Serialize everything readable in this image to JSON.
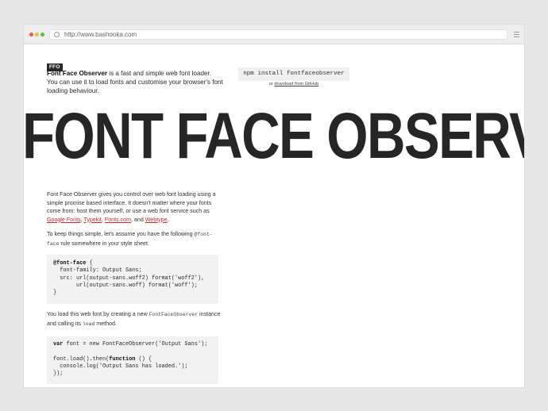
{
  "browser": {
    "url": "http://www.bashooka.com"
  },
  "header": {
    "badge": "FFO",
    "intro_title": "Font Face Observer",
    "intro_text": " is a fast and simple web font loader. You can use it to load fonts and customise your browser's font loading behaviour.",
    "install_command": "npm install fontfaceobserver",
    "or_text": "or ",
    "download_link": "download from GitHub"
  },
  "hero": {
    "title": "FONT FACE OBSERVER"
  },
  "content": {
    "p1_start": "Font Face Observer gives you control over web font loading using a simple promise based interface. It doesn't matter where your fonts come from: host them yourself, or use a web font service such as ",
    "link_google": "Google Fonts",
    "sep1": ", ",
    "link_typekit": "Typekit",
    "sep2": ", ",
    "link_fonts": "Fonts.com",
    "sep3": ", and ",
    "link_webtype": "Webtype",
    "p1_end": ".",
    "p2_start": "To keep things simple, let's assume you have the following ",
    "p2_code": "@font-face",
    "p2_end": " rule somewhere in your style sheet.",
    "code1": {
      "l1_kw": "@font-face",
      "l1_rest": " {",
      "l2": "  font-family: Output Sans;",
      "l3": "  src: url(output-sans.woff2) format('woff2'),",
      "l4": "       url(output-sans.woff) format('woff');",
      "l5": "}"
    },
    "p3_start": "You load this web font by creating a new ",
    "p3_code1": "FontFaceObserver",
    "p3_mid": " instance and calling its ",
    "p3_code2": "load",
    "p3_end": " method.",
    "code2": {
      "l1_kw": "var",
      "l1_rest": " font = new FontFaceObserver('Output Sans');",
      "l2": "",
      "l3_a": "font.load().then(",
      "l3_kw": "function",
      "l3_b": " () {",
      "l4": "  console.log('Output Sans has loaded.');",
      "l5": "});"
    }
  },
  "colors": {
    "link": "#d6272b",
    "hero_text": "#262626",
    "page_bg": "#e7e7e7"
  }
}
